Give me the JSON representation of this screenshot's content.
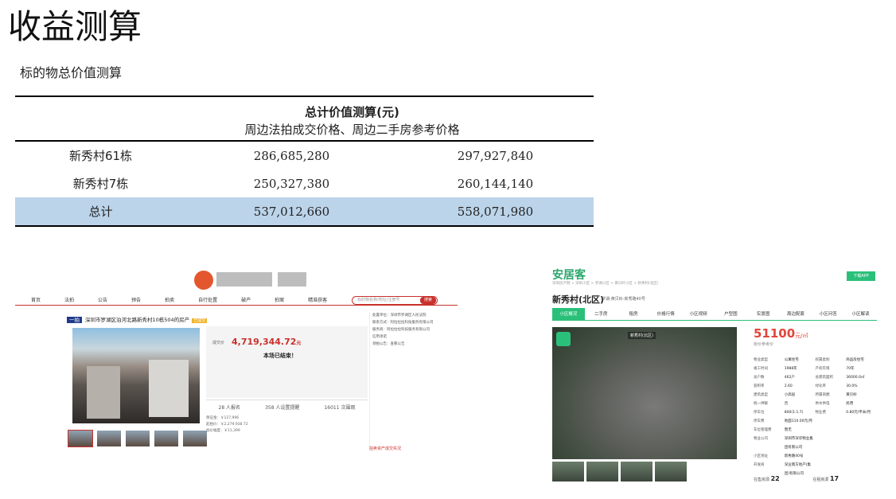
{
  "page": {
    "title": "收益测算",
    "subtitle": "标的物总价值测算"
  },
  "valuation_table": {
    "header_line1": "总计价值测算(元)",
    "header_line2": "周边法拍成交价格、周边二手房参考价格",
    "rows": [
      {
        "name": "新秀村61栋",
        "auction": "286,685,280",
        "secondhand": "297,927,840"
      },
      {
        "name": "新秀村7栋",
        "auction": "250,327,380",
        "secondhand": "260,144,140"
      }
    ],
    "total": {
      "name": "总计",
      "auction": "537,012,660",
      "secondhand": "558,071,980"
    }
  },
  "auction_screenshot": {
    "nav": [
      "首页",
      "法拍",
      "公告",
      "预告",
      "拍卖",
      "拍卖",
      "自行处置",
      "破产",
      "拍案",
      "精准获客"
    ],
    "search_placeholder": "标的物名称/地址/注册号",
    "search_button": "搜索",
    "crumb_badge": "一拍",
    "crumb_title": "深圳市罗湖区泊河北路新秀村10栋504的房产",
    "crumb_tag": "已成交",
    "price_label": "成交价",
    "price": "4,719,344.72",
    "price_unit": "元",
    "ended_text": "本场已结束！",
    "stats": [
      "28 人报名",
      "358 人设置提醒",
      "16011 次围观"
    ],
    "details": [
      "保证金：￥127,996",
      "评估价：￥2,279,938.72",
      "起拍价：￥2,279,938.72",
      "优先购买权人数：无",
      "加价幅度：￥11,399",
      "竞价周期：1天"
    ],
    "side": [
      "处置单位：深圳市罗湖区人民法院",
      "联系方式：阿拉拉拉科技服务有限公司",
      "服务商：阿拉拉拉科技服务有限公司",
      "信用承诺",
      "领拍公告：查看公告"
    ],
    "footer": "拍卖资产成交实况"
  },
  "anjuke_screenshot": {
    "logo": "安居客",
    "app_button": "下载APP",
    "crumb": "深圳房产网 > 深圳小区 > 罗湖小区 > 黄贝岭小区 > 新秀村(北区)",
    "name": "新秀村(北区)",
    "address": "罗湖-黄贝岭-新秀路40号",
    "tabs": [
      "小区概况",
      "二手房",
      "租房",
      "价格行情",
      "小区视频",
      "户型图",
      "实景图",
      "周边配套",
      "小区问答",
      "小区解读"
    ],
    "aerial_label": "新秀村(北区)",
    "price": "51100",
    "price_unit": "元/㎡",
    "price_note": "房价参考价",
    "info_rows": [
      [
        "物业类型",
        "公寓住宅",
        "权属类别",
        "商品房住宅"
      ],
      [
        "竣工时间",
        "1988年",
        "产权年限",
        "70年"
      ],
      [
        "总户数",
        "462户",
        "总建筑面积",
        "36000.0㎡"
      ],
      [
        "容积率",
        "2.60",
        "绿化率",
        "30.0%"
      ],
      [
        "建筑类型",
        "小高层",
        "所属商圈",
        "黄贝岭"
      ],
      [
        "统一供暖",
        "否",
        "供水供电",
        "民用"
      ],
      [
        "停车位",
        "800(1:1.7)",
        "物业费",
        "0.80元/平米/月"
      ],
      [
        "停车费",
        "地面110.00元/月",
        "",
        ""
      ],
      [
        "车位管理费",
        "暂无",
        "",
        ""
      ],
      [
        "物业公司",
        "深圳市深华物业集团有限公司",
        "",
        ""
      ],
      [
        "小区地址",
        "新秀路40号",
        "",
        ""
      ],
      [
        "开发商",
        "深业南方地产(集团)有限公司",
        "",
        ""
      ]
    ],
    "bottom_left_label": "在售房源",
    "bottom_left_value": "22",
    "bottom_right_label": "在租房源",
    "bottom_right_value": "17"
  }
}
